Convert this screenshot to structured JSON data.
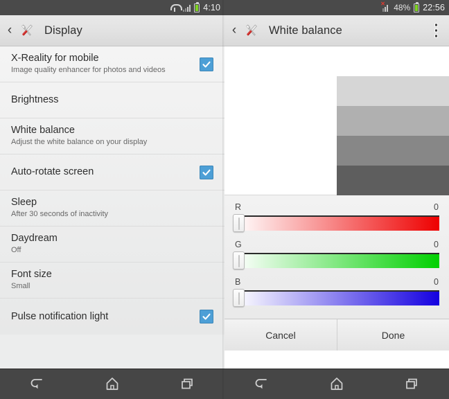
{
  "left": {
    "status_bar": {
      "icons": [
        "connection-icon",
        "signal-icon",
        "battery-icon"
      ],
      "time": "4:10"
    },
    "action_bar": {
      "back_glyph": "‹",
      "app_icon": "settings-tools-icon",
      "title": "Display"
    },
    "settings": [
      {
        "title": "X-Reality for mobile",
        "subtitle": "Image quality enhancer for photos and videos",
        "checked": true
      },
      {
        "title": "Brightness",
        "subtitle": "",
        "checked": false
      },
      {
        "title": "White balance",
        "subtitle": "Adjust the white balance on your display",
        "checked": false
      },
      {
        "title": "Auto-rotate screen",
        "subtitle": "",
        "checked": true
      },
      {
        "title": "Sleep",
        "subtitle": "After 30 seconds of inactivity",
        "checked": false
      },
      {
        "title": "Daydream",
        "subtitle": "Off",
        "checked": false
      },
      {
        "title": "Font size",
        "subtitle": "Small",
        "checked": false
      },
      {
        "title": "Pulse notification light",
        "subtitle": "",
        "checked": true
      }
    ],
    "nav_bar": [
      "back-icon",
      "home-icon",
      "recents-icon"
    ]
  },
  "right": {
    "status_bar": {
      "icons": [
        "signal-no-service-icon",
        "battery-icon"
      ],
      "battery_percent": "48%",
      "time": "22:56"
    },
    "action_bar": {
      "back_glyph": "‹",
      "app_icon": "settings-tools-icon",
      "title": "White balance",
      "overflow": "overflow-menu-icon"
    },
    "preview": {
      "background": "#ffffff",
      "bands": [
        "#d6d6d6",
        "#b0b0b0",
        "#878787",
        "#5e5e5e"
      ]
    },
    "sliders": [
      {
        "name": "R",
        "value": "0",
        "gradient_from": "#ffffff",
        "gradient_to": "#ee0000",
        "thumb_pct": 0
      },
      {
        "name": "G",
        "value": "0",
        "gradient_from": "#ffffff",
        "gradient_to": "#00d000",
        "thumb_pct": 0
      },
      {
        "name": "B",
        "value": "0",
        "gradient_from": "#ffffff",
        "gradient_to": "#1400e0",
        "thumb_pct": 0
      }
    ],
    "buttons": {
      "cancel": "Cancel",
      "done": "Done"
    },
    "nav_bar": [
      "back-icon",
      "home-icon",
      "recents-icon"
    ]
  },
  "colors": {
    "accent_checkbox": "#4d9fd6",
    "status_bar_bg": "#4a4a4a",
    "nav_bar_bg": "#464646",
    "battery_green": "#7ed321"
  }
}
